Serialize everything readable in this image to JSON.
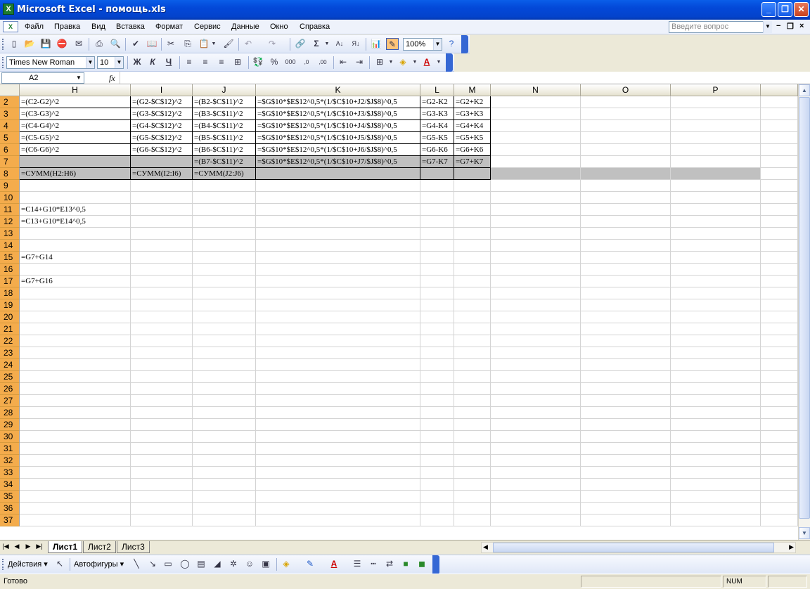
{
  "window": {
    "title": "Microsoft Excel - помощь.xls",
    "app_icon": "X"
  },
  "menu": {
    "items": [
      "Файл",
      "Правка",
      "Вид",
      "Вставка",
      "Формат",
      "Сервис",
      "Данные",
      "Окно",
      "Справка"
    ],
    "ask_placeholder": "Введите вопрос"
  },
  "toolbar": {
    "zoom": "100%",
    "font_name": "Times New Roman",
    "font_size": "10"
  },
  "formula_bar": {
    "name_box": "A2",
    "fx": "fx",
    "formula": ""
  },
  "columns": [
    "H",
    "I",
    "J",
    "K",
    "L",
    "M",
    "N",
    "O",
    "P"
  ],
  "rows": [
    {
      "n": "2",
      "H": "=(C2-G2)^2",
      "I": "=(G2-$C$12)^2",
      "J": "=(B2-$C$11)^2",
      "K": "=$G$10*$E$12^0,5*(1/$C$10+J2/$J$8)^0,5",
      "L": "=G2-K2",
      "M": "=G2+K2"
    },
    {
      "n": "3",
      "H": "=(C3-G3)^2",
      "I": "=(G3-$C$12)^2",
      "J": "=(B3-$C$11)^2",
      "K": "=$G$10*$E$12^0,5*(1/$C$10+J3/$J$8)^0,5",
      "L": "=G3-K3",
      "M": "=G3+K3"
    },
    {
      "n": "4",
      "H": "=(C4-G4)^2",
      "I": "=(G4-$C$12)^2",
      "J": "=(B4-$C$11)^2",
      "K": "=$G$10*$E$12^0,5*(1/$C$10+J4/$J$8)^0,5",
      "L": "=G4-K4",
      "M": "=G4+K4"
    },
    {
      "n": "5",
      "H": "=(C5-G5)^2",
      "I": "=(G5-$C$12)^2",
      "J": "=(B5-$C$11)^2",
      "K": "=$G$10*$E$12^0,5*(1/$C$10+J5/$J$8)^0,5",
      "L": "=G5-K5",
      "M": "=G5+K5"
    },
    {
      "n": "6",
      "H": "=(C6-G6)^2",
      "I": "=(G6-$C$12)^2",
      "J": "=(B6-$C$11)^2",
      "K": "=$G$10*$E$12^0,5*(1/$C$10+J6/$J$8)^0,5",
      "L": "=G6-K6",
      "M": "=G6+K6"
    },
    {
      "n": "7",
      "H": "",
      "I": "",
      "J": "=(B7-$C$11)^2",
      "K": "=$G$10*$E$12^0,5*(1/$C$10+J7/$J$8)^0,5",
      "L": "=G7-K7",
      "M": "=G7+K7"
    },
    {
      "n": "8",
      "H": "=СУММ(H2:H6)",
      "I": "=СУММ(I2:I6)",
      "J": "=СУММ(J2:J6)",
      "K": "",
      "L": "",
      "M": ""
    },
    {
      "n": "9",
      "H": ""
    },
    {
      "n": "10",
      "H": ""
    },
    {
      "n": "11",
      "H": "=C14+G10*E13^0,5"
    },
    {
      "n": "12",
      "H": "=C13+G10*E14^0,5"
    },
    {
      "n": "13",
      "H": ""
    },
    {
      "n": "14",
      "H": ""
    },
    {
      "n": "15",
      "H": "=G7+G14"
    },
    {
      "n": "16",
      "H": ""
    },
    {
      "n": "17",
      "H": "=G7+G16"
    },
    {
      "n": "18"
    },
    {
      "n": "19"
    },
    {
      "n": "20"
    },
    {
      "n": "21"
    },
    {
      "n": "22"
    },
    {
      "n": "23"
    },
    {
      "n": "24"
    },
    {
      "n": "25"
    },
    {
      "n": "26"
    },
    {
      "n": "27"
    },
    {
      "n": "28"
    },
    {
      "n": "29"
    },
    {
      "n": "30"
    },
    {
      "n": "31"
    },
    {
      "n": "32"
    },
    {
      "n": "33"
    },
    {
      "n": "34"
    },
    {
      "n": "35"
    },
    {
      "n": "36"
    },
    {
      "n": "37"
    }
  ],
  "sheets": [
    "Лист1",
    "Лист2",
    "Лист3"
  ],
  "active_sheet": "Лист1",
  "drawing": {
    "actions": "Действия",
    "autoshapes": "Автофигуры"
  },
  "status": {
    "ready": "Готово",
    "num": "NUM"
  },
  "colors": {
    "title_bar": "#0348d8",
    "row_header_selected": "#f4ac4c",
    "gray_fill": "#c0c0c0"
  }
}
